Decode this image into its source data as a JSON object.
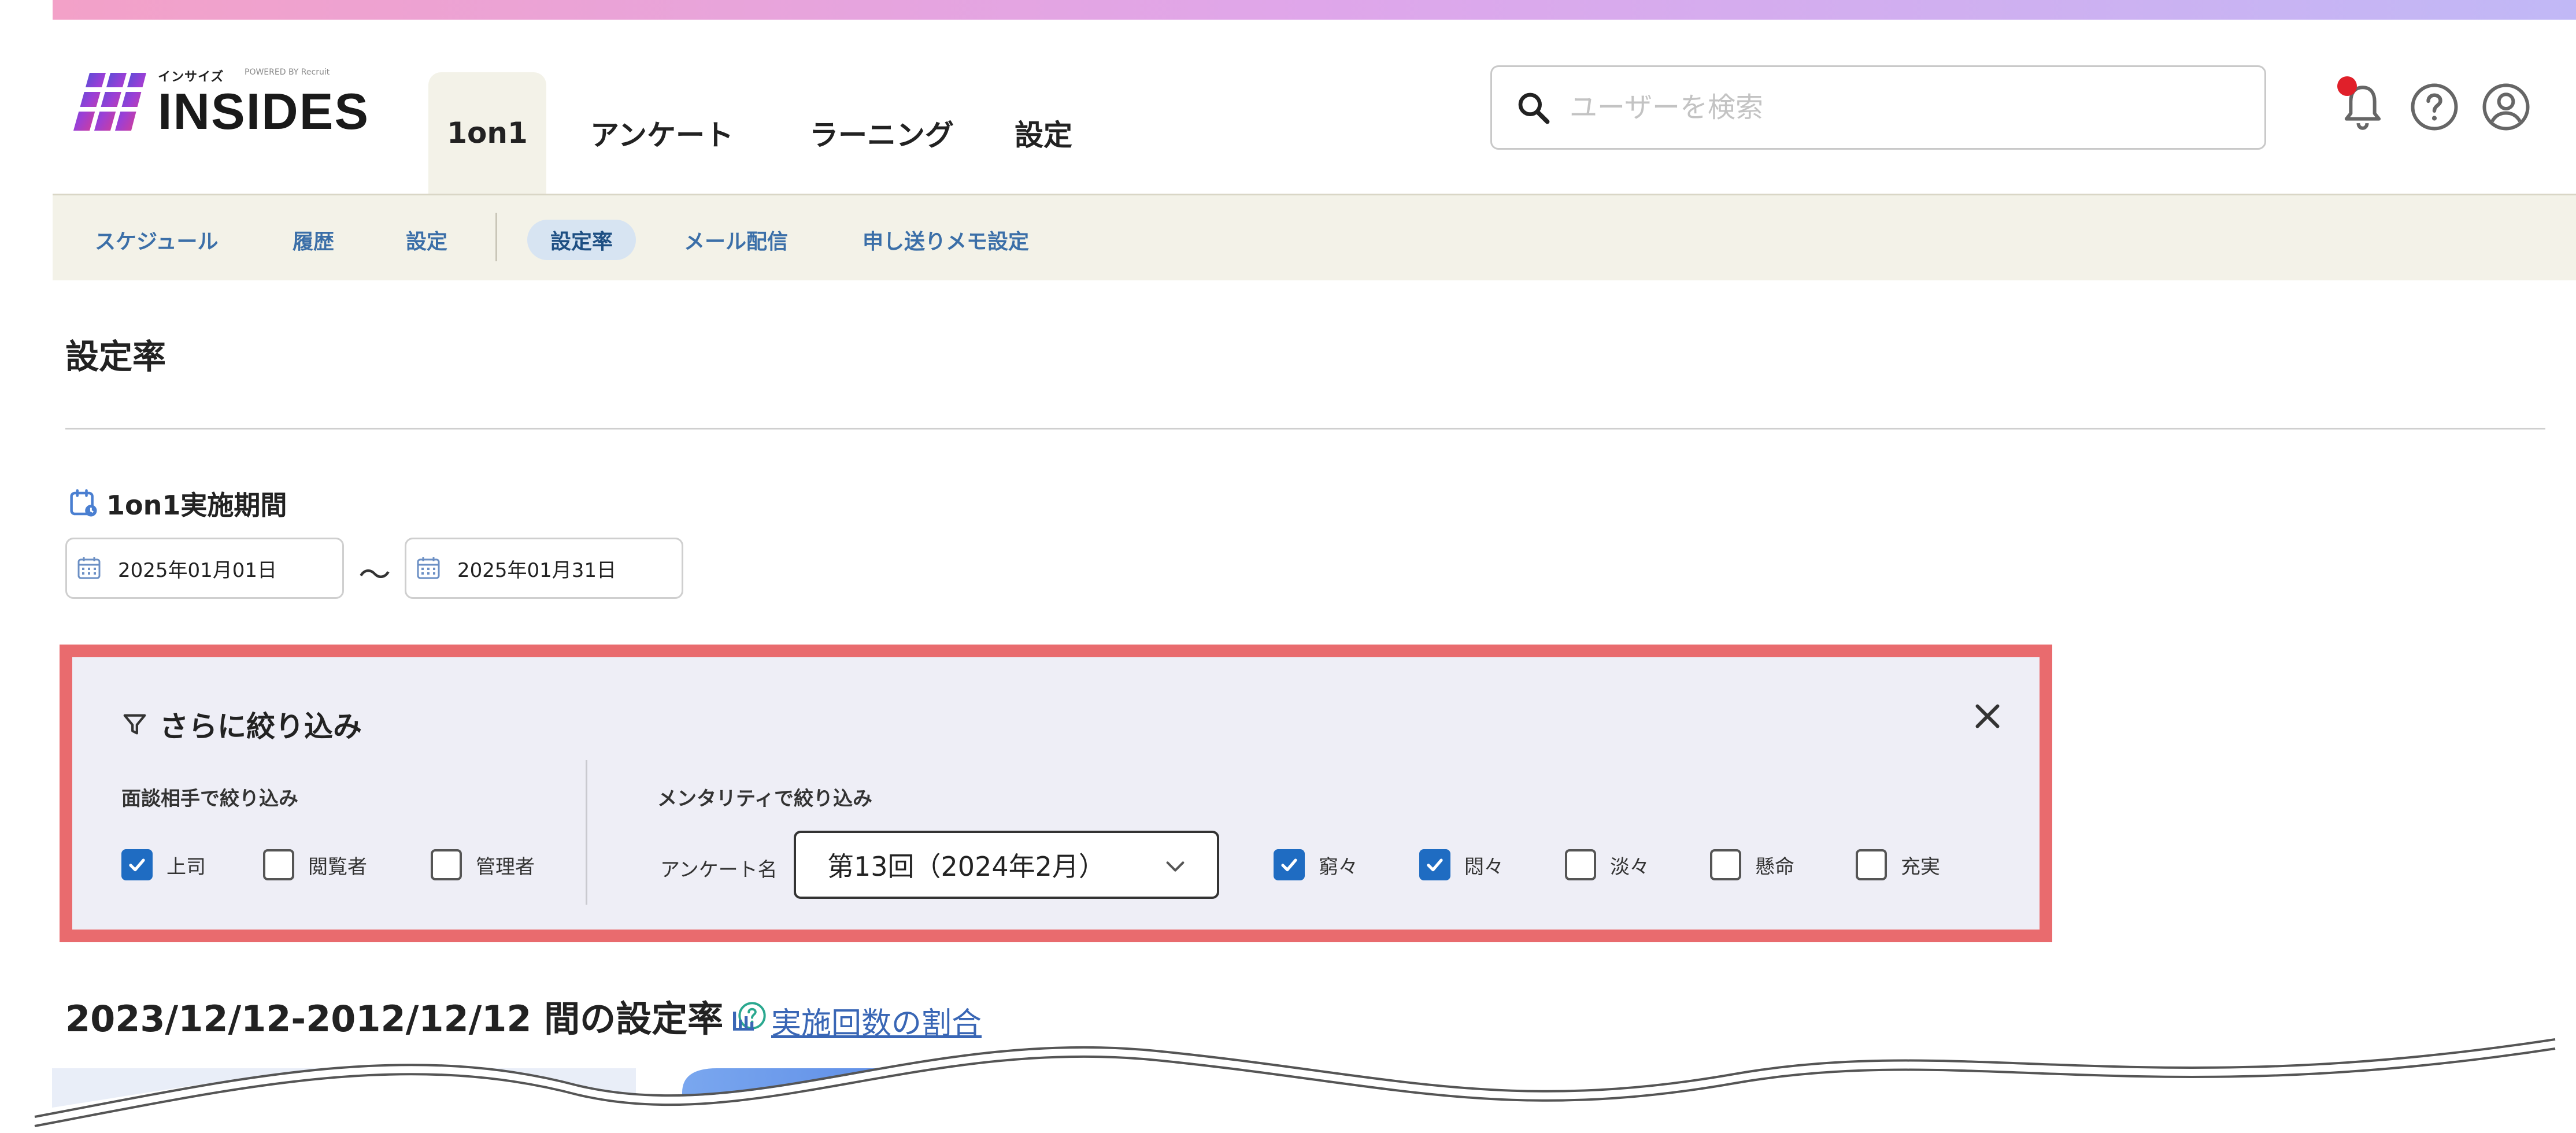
{
  "brand": {
    "kana": "インサイズ",
    "powered": "POWERED BY Recruit",
    "name": "INSIDES"
  },
  "main_tabs": [
    {
      "label": "1on1",
      "active": true
    },
    {
      "label": "アンケート",
      "active": false
    },
    {
      "label": "ラーニング",
      "active": false
    },
    {
      "label": "設定",
      "active": false
    }
  ],
  "search": {
    "placeholder": "ユーザーを検索",
    "value": ""
  },
  "header_icons": [
    "bell-icon",
    "help-icon",
    "account-icon"
  ],
  "sub_nav": [
    {
      "label": "スケジュール",
      "active": false
    },
    {
      "label": "履歴",
      "active": false
    },
    {
      "label": "設定",
      "active": false
    },
    {
      "label": "設定率",
      "active": true
    },
    {
      "label": "メール配信",
      "active": false
    },
    {
      "label": "申し送りメモ設定",
      "active": false
    }
  ],
  "page_title": "設定率",
  "period": {
    "label": "1on1実施期間",
    "start": "2025年01月01日",
    "end": "2025年01月31日",
    "separator": "〜"
  },
  "filter": {
    "title": "さらに絞り込み",
    "partner_section": "面談相手で絞り込み",
    "partner_options": [
      {
        "label": "上司",
        "checked": true
      },
      {
        "label": "閲覧者",
        "checked": false
      },
      {
        "label": "管理者",
        "checked": false
      }
    ],
    "mentality_section": "メンタリティで絞り込み",
    "survey_label": "アンケート名",
    "survey_selected": "第13回（2024年2月）",
    "mentality_options": [
      {
        "label": "窮々",
        "checked": true
      },
      {
        "label": "悶々",
        "checked": true
      },
      {
        "label": "淡々",
        "checked": false
      },
      {
        "label": "懸命",
        "checked": false
      },
      {
        "label": "充実",
        "checked": false
      }
    ]
  },
  "stats": {
    "title": "2023/12/12-2012/12/12 間の設定率",
    "link": "実施回数の割合"
  },
  "colors": {
    "accent": "#1f6cc2",
    "filter_border": "#e96b6e",
    "subnav_bg": "#f3f2e8",
    "link": "#3966b5",
    "notification": "#e0202a"
  }
}
